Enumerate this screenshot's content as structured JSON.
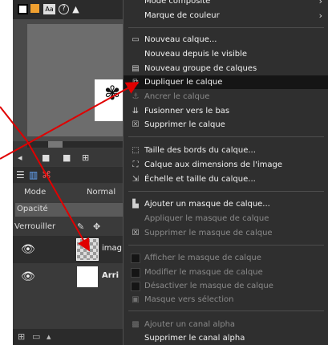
{
  "toolbar": {
    "aa_label": "Aa",
    "help_glyph": "?",
    "triangle_glyph": "▲"
  },
  "layers_panel": {
    "mode_label": "Mode",
    "mode_value": "Normal",
    "opacity_label": "Opacité",
    "lock_label": "Verrouiller",
    "layers": [
      {
        "name": "imag",
        "thumb": "checker",
        "selected": true
      },
      {
        "name": "Arri",
        "thumb": "white",
        "selected": false
      }
    ]
  },
  "menu": {
    "items": [
      {
        "label": "Mode composite",
        "icon": "",
        "arrow": true,
        "disabled": false,
        "highlighted": false
      },
      {
        "label": "Marque de couleur",
        "icon": "",
        "arrow": true,
        "disabled": false,
        "highlighted": false
      },
      {
        "label": "Nouveau calque...",
        "icon": "new-layer-icon",
        "disabled": false,
        "highlighted": false
      },
      {
        "label": "Nouveau depuis le visible",
        "icon": "",
        "disabled": false,
        "highlighted": false
      },
      {
        "label": "Nouveau groupe de calques",
        "icon": "layer-group-icon",
        "disabled": false,
        "highlighted": false
      },
      {
        "label": "Dupliquer le calque",
        "icon": "duplicate-icon",
        "disabled": false,
        "highlighted": true
      },
      {
        "label": "Ancrer le calque",
        "icon": "anchor-icon",
        "disabled": true,
        "highlighted": false
      },
      {
        "label": "Fusionner vers le bas",
        "icon": "merge-down-icon",
        "disabled": false,
        "highlighted": false
      },
      {
        "label": "Supprimer le calque",
        "icon": "delete-icon",
        "disabled": false,
        "highlighted": false
      },
      {
        "label": "Taille des bords du calque...",
        "icon": "layer-boundary-icon",
        "disabled": false,
        "highlighted": false
      },
      {
        "label": "Calque aux dimensions de l'image",
        "icon": "layer-to-image-icon",
        "disabled": false,
        "highlighted": false
      },
      {
        "label": "Échelle et taille du calque...",
        "icon": "scale-icon",
        "disabled": false,
        "highlighted": false
      },
      {
        "label": "Ajouter un masque de calque...",
        "icon": "add-mask-icon",
        "disabled": false,
        "highlighted": false
      },
      {
        "label": "Appliquer le masque de calque",
        "icon": "",
        "disabled": true,
        "highlighted": false
      },
      {
        "label": "Supprimer le masque de calque",
        "icon": "delete-mask-icon",
        "disabled": true,
        "highlighted": false
      },
      {
        "label": "Afficher le masque de calque",
        "icon": "checkbox",
        "disabled": true,
        "highlighted": false
      },
      {
        "label": "Modifier le masque de calque",
        "icon": "checkbox",
        "disabled": true,
        "highlighted": false
      },
      {
        "label": "Désactiver le masque de calque",
        "icon": "checkbox",
        "disabled": true,
        "highlighted": false
      },
      {
        "label": "Masque vers sélection",
        "icon": "mask-to-selection-icon",
        "disabled": true,
        "highlighted": false
      },
      {
        "label": "Ajouter un canal alpha",
        "icon": "alpha-icon",
        "disabled": true,
        "highlighted": false
      },
      {
        "label": "Supprimer le canal alpha",
        "icon": "",
        "disabled": false,
        "highlighted": false
      }
    ]
  },
  "colors": {
    "annotation_arrow": "#e00000",
    "menu_bg": "#2f2f2f",
    "highlight_bg": "#151515",
    "disabled_text": "#8a8a8a"
  }
}
